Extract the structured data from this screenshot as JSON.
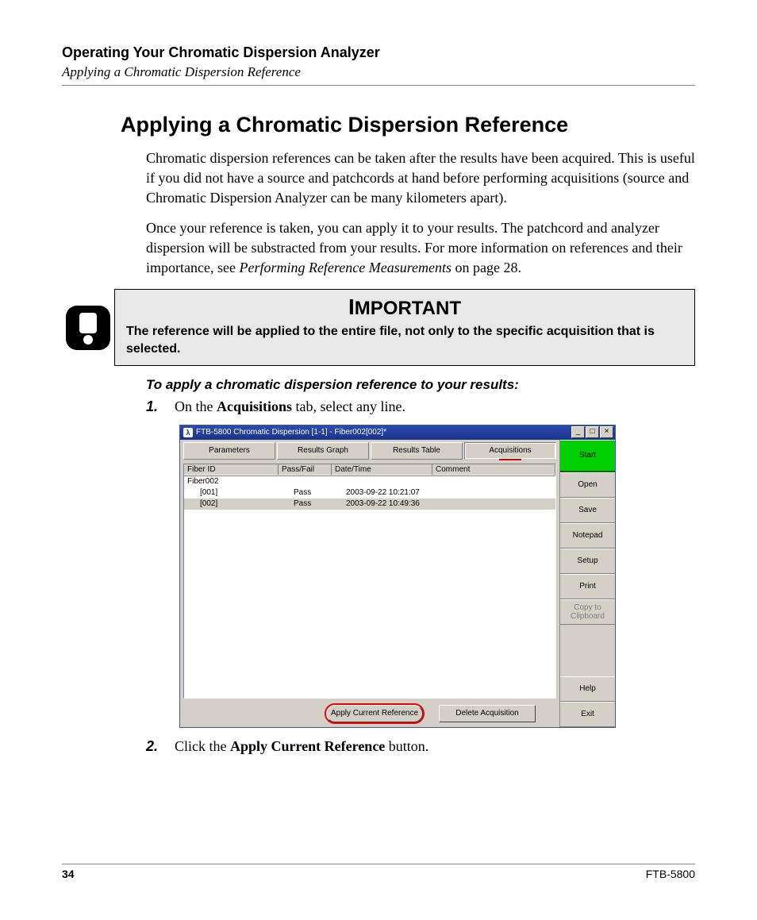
{
  "header": {
    "chapter": "Operating Your Chromatic Dispersion Analyzer",
    "section": "Applying a Chromatic Dispersion Reference"
  },
  "title": "Applying a Chromatic Dispersion Reference",
  "para1": "Chromatic dispersion references can be taken after the results have been acquired. This is useful if you did not have a source and patchcords at hand before performing acquisitions (source and Chromatic Dispersion Analyzer can be many kilometers apart).",
  "para2a": "Once your reference is taken, you can apply it to your results. The patchcord and analyzer dispersion will be substracted from your results. For more information on references and their importance, see ",
  "para2b": "Performing Reference Measurements",
  "para2c": " on page 28.",
  "important": {
    "label_rest": "MPORTANT",
    "label_initial": "I",
    "body": "The reference will be applied to the entire file, not only to the specific acquisition that is selected."
  },
  "procedure_heading": "To apply a chromatic dispersion reference to your results:",
  "step1": {
    "num": "1.",
    "pre": "On the ",
    "bold": "Acquisitions",
    "post": " tab, select any line."
  },
  "step2": {
    "num": "2.",
    "pre": "Click the ",
    "bold": "Apply Current Reference",
    "post": " button."
  },
  "screenshot": {
    "titlebar": {
      "icon_text": "λ",
      "text": "FTB-5800 Chromatic Dispersion  [1-1] - Fiber002[002]*",
      "btn_min": "_",
      "btn_max": "□",
      "btn_close": "×"
    },
    "tabs": [
      "Parameters",
      "Results Graph",
      "Results Table",
      "Acquisitions"
    ],
    "grid": {
      "headers": [
        "Fiber ID",
        "Pass/Fail",
        "Date/Time",
        "Comment"
      ],
      "rows": [
        {
          "fid": "Fiber002",
          "pf": "",
          "dt": "",
          "cm": "",
          "indent": false,
          "sel": false
        },
        {
          "fid": "[001]",
          "pf": "Pass",
          "dt": "2003-09-22 10:21:07",
          "cm": "",
          "indent": true,
          "sel": false
        },
        {
          "fid": "[002]",
          "pf": "Pass",
          "dt": "2003-09-22 10:49:36",
          "cm": "",
          "indent": true,
          "sel": true
        }
      ]
    },
    "bottom_buttons": {
      "apply": "Apply Current Reference",
      "delete": "Delete Acquisition"
    },
    "sidebar": {
      "start": "Start",
      "open": "Open",
      "save": "Save",
      "notepad": "Notepad",
      "setup": "Setup",
      "print": "Print",
      "copy": "Copy to Clipboard",
      "help": "Help",
      "exit": "Exit"
    }
  },
  "footer": {
    "page": "34",
    "model": "FTB-5800"
  }
}
